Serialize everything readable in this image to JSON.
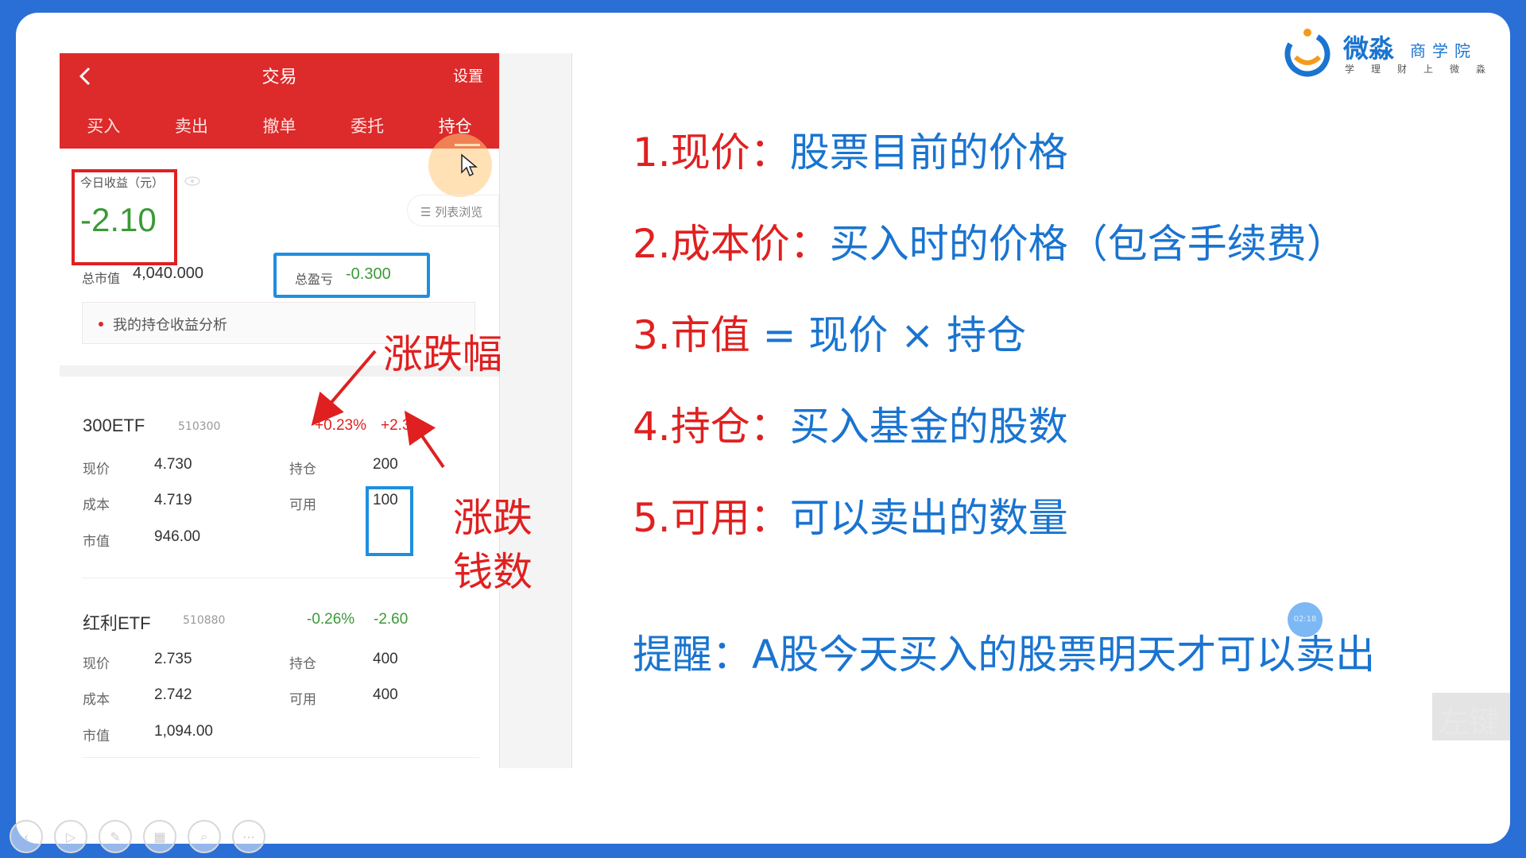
{
  "phone": {
    "header_title": "交易",
    "settings": "设置",
    "tabs": [
      "买入",
      "卖出",
      "撤单",
      "委托",
      "持仓"
    ],
    "active_tab": "持仓",
    "today_label": "今日收益（元）",
    "today_value": "-2.10",
    "list_view": "☰ 列表浏览",
    "total_mv_label": "总市值",
    "total_mv_value": "4,040.000",
    "total_pl_label": "总盈亏",
    "total_pl_value": "-0.300",
    "analysis": "我的持仓收益分析",
    "labels": {
      "price": "现价",
      "cost": "成本",
      "mv": "市值",
      "hold": "持仓",
      "avail": "可用"
    },
    "stocks": [
      {
        "name": "300ETF",
        "code": "510300",
        "pct": "+0.23%",
        "chg": "+2.30",
        "price": "4.730",
        "cost": "4.719",
        "mv": "946.00",
        "hold": "200",
        "avail": "100"
      },
      {
        "name": "红利ETF",
        "code": "510880",
        "pct": "-0.26%",
        "chg": "-2.60",
        "price": "2.735",
        "cost": "2.742",
        "mv": "1,094.00",
        "hold": "400",
        "avail": "400"
      }
    ]
  },
  "annotations": {
    "amplitude": "涨跌幅",
    "money_1": "涨跌",
    "money_2": "钱数"
  },
  "points": [
    {
      "num": "1.现价：",
      "txt": "股票目前的价格"
    },
    {
      "num": "2.成本价：",
      "txt": "买入时的价格（包含手续费）"
    },
    {
      "num": "3.市值 ",
      "txt": "= 现价 × 持仓"
    },
    {
      "num": "4.持仓：",
      "txt": "买入基金的股数"
    },
    {
      "num": "5.可用：",
      "txt": "可以卖出的数量"
    }
  ],
  "reminder": "提醒：A股今天买入的股票明天才可以卖出",
  "timer": "02:18",
  "logo": {
    "name": "微淼",
    "sub1": "商学院",
    "sub2": "学理财上微淼"
  },
  "watermark": "左键",
  "colors": {
    "accent_red": "#dd2a2a",
    "rise": "#e02020",
    "fall": "#3a9a36",
    "accent_blue": "#1a74d0",
    "frame": "#2a6fd6"
  }
}
